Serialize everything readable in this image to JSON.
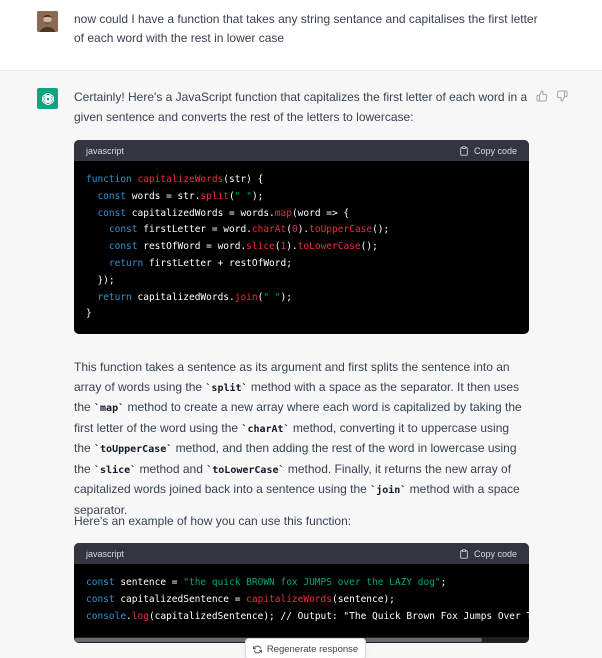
{
  "user_message": {
    "text": "now could I have a function that takes any string sentance and capitalises the first letter of each word with the rest in lower case"
  },
  "assistant": {
    "intro": "Certainly! Here's a JavaScript function that capitalizes the first letter of each word in a given sentence and converts the rest of the letters to lowercase:",
    "code_block_1": {
      "language": "javascript",
      "copy_label": "Copy code",
      "lines": [
        "function capitalizeWords(str) {",
        "  const words = str.split(\" \");",
        "  const capitalizedWords = words.map(word => {",
        "    const firstLetter = word.charAt(0).toUpperCase();",
        "    const restOfWord = word.slice(1).toLowerCase();",
        "    return firstLetter + restOfWord;",
        "  });",
        "  return capitalizedWords.join(\" \");",
        "}"
      ]
    },
    "explanation": {
      "p1": "This function takes a sentence as its argument and first splits the sentence into an array of words using the ",
      "c1": "`split`",
      "p2": " method with a space as the separator. It then uses the ",
      "c2": "`map`",
      "p3": " method to create a new array where each word is capitalized by taking the first letter of the word using the ",
      "c3": "`charAt`",
      "p4": " method, converting it to uppercase using the ",
      "c4": "`toUpperCase`",
      "p5": " method, and then adding the rest of the word in lowercase using the ",
      "c5": "`slice`",
      "p6": " method and ",
      "c6": "`toLowerCase`",
      "p7": " method. Finally, it returns the new array of capitalized words joined back into a sentence using the ",
      "c7": "`join`",
      "p8": " method with a space separator."
    },
    "example_intro": "Here's an example of how you can use this function:",
    "code_block_2": {
      "language": "javascript",
      "copy_label": "Copy code",
      "lines": [
        "const sentence = \"the quick BROWN fox JUMPS over the LAZY dog\";",
        "const capitalizedSentence = capitalizeWords(sentence);",
        "console.log(capitalizedSentence); // Output: \"The Quick Brown Fox Jumps Over The La"
      ]
    }
  },
  "regenerate_label": "Regenerate response",
  "colors": {
    "brand": "#10a37f",
    "code_bg": "#000000",
    "code_header": "#343541",
    "keyword": "#2e95d3",
    "function": "#f22c3d",
    "string": "#00a67d",
    "number": "#df3079"
  },
  "icons": [
    "user-avatar",
    "chatgpt-logo-icon",
    "thumbs-up-icon",
    "thumbs-down-icon",
    "clipboard-icon",
    "refresh-icon"
  ]
}
